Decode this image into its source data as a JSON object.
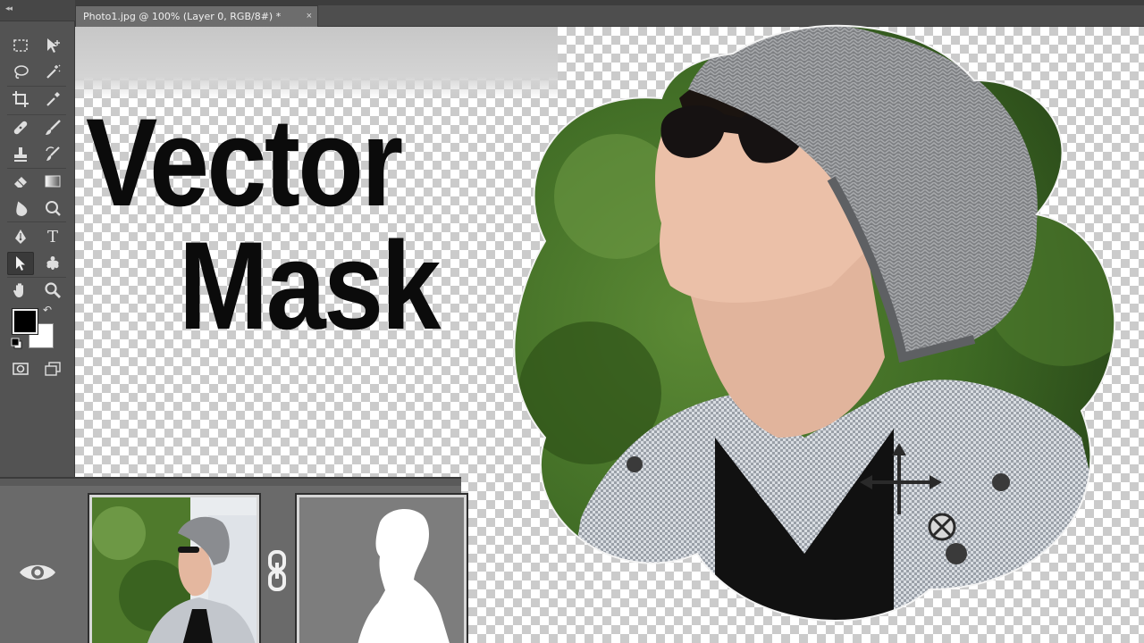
{
  "document": {
    "tab_label": "Photo1.jpg @ 100% (Layer 0, RGB/8#) *",
    "close_glyph": "×"
  },
  "headline": {
    "line1": "Vector",
    "line2": "Mask"
  },
  "toolbar": {
    "grip_glyph": "◂◂",
    "tools": [
      {
        "name": "rectangular-marquee-icon"
      },
      {
        "name": "move-icon"
      },
      {
        "name": "lasso-icon"
      },
      {
        "name": "quick-selection-icon"
      },
      {
        "name": "crop-icon"
      },
      {
        "name": "eyedropper-icon"
      },
      {
        "name": "spot-healing-icon"
      },
      {
        "name": "brush-icon"
      },
      {
        "name": "clone-stamp-icon"
      },
      {
        "name": "history-brush-icon"
      },
      {
        "name": "eraser-icon"
      },
      {
        "name": "gradient-icon"
      },
      {
        "name": "blur-icon"
      },
      {
        "name": "dodge-icon"
      },
      {
        "name": "pen-icon"
      },
      {
        "name": "type-icon"
      },
      {
        "name": "path-selection-icon"
      },
      {
        "name": "custom-shape-icon"
      },
      {
        "name": "hand-icon"
      },
      {
        "name": "zoom-icon"
      },
      {
        "name": "quick-mask-icon"
      },
      {
        "name": "screen-mode-icon"
      }
    ],
    "type_tool_glyph": "T",
    "swap_glyph": "↶",
    "colors": {
      "foreground": "#000000",
      "background": "#ffffff"
    }
  },
  "layers": {
    "visibility_icon": "eye-icon",
    "link_icon": "chain-link-icon"
  },
  "colors": {
    "ui_dark": "#535353",
    "canvas_checker": "#cbcbcb",
    "headline": "#0b0b0b"
  }
}
